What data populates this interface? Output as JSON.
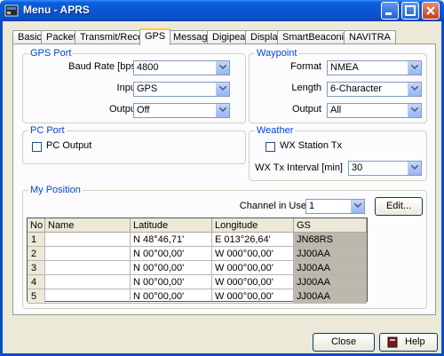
{
  "window": {
    "title": "Menu - APRS"
  },
  "tabs": [
    "Basic",
    "Packet",
    "Transmit/Receive",
    "GPS",
    "Message",
    "Digipeat",
    "Display",
    "SmartBeaconing",
    "NAVITRA"
  ],
  "gps_port": {
    "legend": "GPS Port",
    "baud_label": "Baud Rate [bps]",
    "baud_value": "4800",
    "input_label": "Input",
    "input_value": "GPS",
    "output_label": "Output",
    "output_value": "Off"
  },
  "waypoint": {
    "legend": "Waypoint",
    "format_label": "Format",
    "format_value": "NMEA",
    "length_label": "Length",
    "length_value": "6-Character",
    "output_label": "Output",
    "output_value": "All"
  },
  "pc_port": {
    "legend": "PC Port",
    "pc_output_label": "PC Output",
    "pc_output_checked": false
  },
  "weather": {
    "legend": "Weather",
    "wx_station_label": "WX Station Tx",
    "wx_station_checked": false,
    "interval_label": "WX Tx Interval [min]",
    "interval_value": "30"
  },
  "my_position": {
    "legend": "My Position",
    "channel_label": "Channel in Use",
    "channel_value": "1",
    "edit_label": "Edit...",
    "columns": [
      "No",
      "Name",
      "Latitude",
      "Longitude",
      "GS"
    ],
    "rows": [
      {
        "no": "1",
        "name": "",
        "lat": "N 48°46,71'",
        "lon": "E 013°26,64'",
        "gs": "JN68RS"
      },
      {
        "no": "2",
        "name": "",
        "lat": "N 00°00,00'",
        "lon": "W 000°00,00'",
        "gs": "JJ00AA"
      },
      {
        "no": "3",
        "name": "",
        "lat": "N 00°00,00'",
        "lon": "W 000°00,00'",
        "gs": "JJ00AA"
      },
      {
        "no": "4",
        "name": "",
        "lat": "N 00°00,00'",
        "lon": "W 000°00,00'",
        "gs": "JJ00AA"
      },
      {
        "no": "5",
        "name": "",
        "lat": "N 00°00,00'",
        "lon": "W 000°00,00'",
        "gs": "JJ00AA"
      }
    ]
  },
  "footer": {
    "close_label": "Close",
    "help_label": "Help"
  },
  "icons": {
    "app": "app-icon",
    "minimize": "minimize-icon",
    "maximize": "maximize-icon",
    "close": "close-icon",
    "help": "help-book-icon",
    "dropdown": "chevron-down-icon"
  }
}
